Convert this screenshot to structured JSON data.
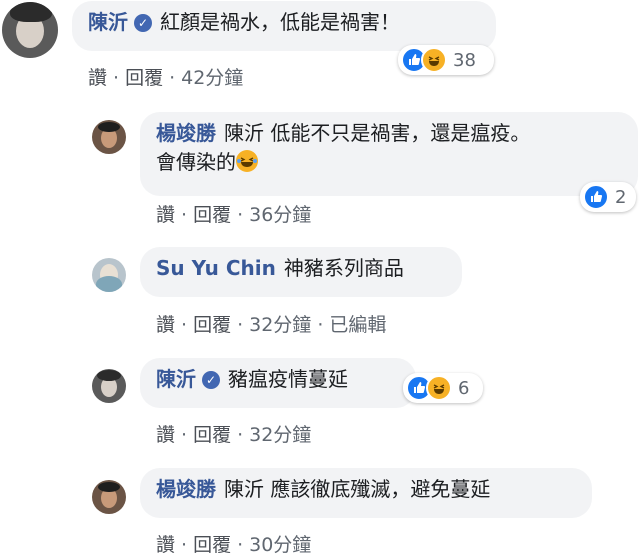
{
  "comments": [
    {
      "author": "陳沂",
      "verified": true,
      "text": "紅顏是禍水，低能是禍害！",
      "actions": {
        "like": "讚",
        "reply": "回覆",
        "time": "42分鐘"
      },
      "reactions": {
        "types": [
          "like-icon",
          "haha-icon"
        ],
        "count": "38"
      }
    },
    {
      "author": "楊竣勝",
      "verified": false,
      "text_line1": "陳沂 低能不只是禍害，還是瘟疫。",
      "text_line2": "會傳染的",
      "emoji": "laughing-tears-emoji",
      "actions": {
        "like": "讚",
        "reply": "回覆",
        "time": "36分鐘"
      },
      "reactions": {
        "types": [
          "like-icon"
        ],
        "count": "2"
      }
    },
    {
      "author": "Su Yu Chin",
      "verified": false,
      "text": "神豬系列商品",
      "actions": {
        "like": "讚",
        "reply": "回覆",
        "time": "32分鐘",
        "edited": "已編輯"
      }
    },
    {
      "author": "陳沂",
      "verified": true,
      "text": "豬瘟疫情蔓延",
      "actions": {
        "like": "讚",
        "reply": "回覆",
        "time": "32分鐘"
      },
      "reactions": {
        "types": [
          "like-icon",
          "haha-icon"
        ],
        "count": "6"
      }
    },
    {
      "author": "楊竣勝",
      "verified": false,
      "text": "陳沂 應該徹底殲滅，避免蔓延",
      "actions": {
        "like": "讚",
        "reply": "回覆",
        "time": "30分鐘"
      }
    }
  ],
  "colors": {
    "name": "#385898",
    "bubble": "#f2f3f5",
    "meta": "#606770",
    "like": "#1877f2",
    "haha": "#f7b125"
  }
}
